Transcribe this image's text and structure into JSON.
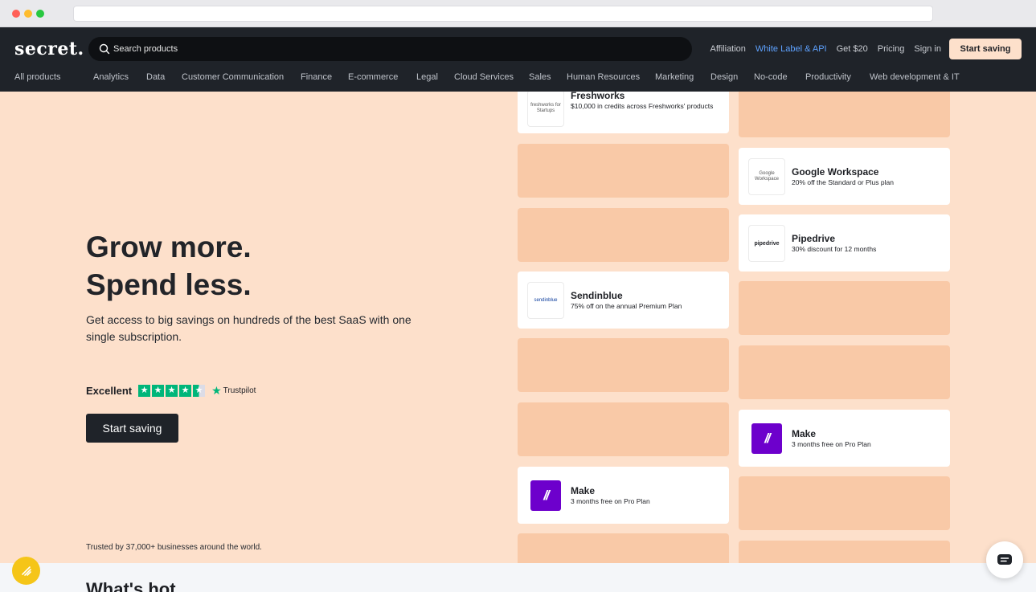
{
  "header": {
    "logo": "secret.",
    "search_placeholder": "Search products",
    "links": {
      "affiliation": "Affiliation",
      "white_label": "White Label & API",
      "get20": "Get $20",
      "pricing": "Pricing",
      "signin": "Sign in"
    },
    "cta": "Start saving",
    "categories": [
      "All products",
      "Analytics",
      "Data",
      "Customer Communication",
      "Finance",
      "E-commerce",
      "Legal",
      "Cloud Services",
      "Sales",
      "Human Resources",
      "Marketing",
      "Design",
      "No-code",
      "Productivity",
      "Web development & IT"
    ]
  },
  "hero": {
    "line1": "Grow more.",
    "line2": "Spend less.",
    "subtitle": "Get access to big savings on hundreds of the best SaaS with one single subscription.",
    "rating_label": "Excellent",
    "rating_stars": 4.5,
    "trustpilot": "Trustpilot",
    "cta": "Start saving",
    "trusted": "Trusted by 37,000+ businesses around the world."
  },
  "deals": {
    "freshworks": {
      "name": "Freshworks",
      "desc": "$10,000 in credits across Freshworks' products",
      "logo_text": "freshworks for Startups"
    },
    "google": {
      "name": "Google Workspace",
      "desc": "20% off the Standard or Plus plan",
      "logo_text": "Google Workspace"
    },
    "pipedrive": {
      "name": "Pipedrive",
      "desc": "30% discount for 12 months",
      "logo_text": "pipedrive"
    },
    "sendinblue": {
      "name": "Sendinblue",
      "desc": "75% off on the annual Premium Plan",
      "logo_text": "sendinblue"
    },
    "make1": {
      "name": "Make",
      "desc": "3 months free on Pro Plan"
    },
    "make2": {
      "name": "Make",
      "desc": "3 months free on Pro Plan"
    }
  },
  "bottom": {
    "heading": "What's hot"
  },
  "colors": {
    "header_bg": "#1f2329",
    "page_bg": "#fde0cb",
    "card_blank": "#f9c9a7",
    "accent_link": "#5ea2ff",
    "trustpilot_green": "#00b67a",
    "make_purple": "#6d00cc"
  }
}
